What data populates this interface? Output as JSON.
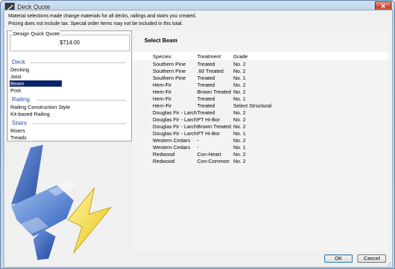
{
  "window": {
    "title": "Deck Quote",
    "close_glyph": "✕"
  },
  "notice": [
    "Material selections made change materials for all decks, railings and stairs you created.",
    "Pricing does not include tax.  Special order items may not be included in this total."
  ],
  "quote": {
    "label": "Design Quick Quote",
    "total": "$714.00"
  },
  "categories": {
    "deck": {
      "header": "Deck",
      "items": [
        "Decking",
        "Joist",
        "Beam",
        "Post"
      ]
    },
    "railing": {
      "header": "Railing",
      "items": [
        "Railing Construction Style",
        "Kit-based Railing"
      ]
    },
    "stairs": {
      "header": "Stairs",
      "items": [
        "Risers",
        "Treads"
      ]
    },
    "selected": "Beam"
  },
  "main": {
    "title": "Select Beam",
    "columns": [
      "Species",
      "Treatment",
      "Grade"
    ],
    "rows": [
      [
        "Southern Pine",
        "Treated",
        "No. 2"
      ],
      [
        "Southern Pine",
        ".60 Treated",
        "No. 2"
      ],
      [
        "Southern Pine",
        "Treated",
        "No. 1"
      ],
      [
        "Hem-Fir",
        "Treated",
        "No. 2"
      ],
      [
        "Hem-Fir",
        "Brown Treated",
        "No. 2"
      ],
      [
        "Hem-Fir",
        "Treated",
        "No. 1"
      ],
      [
        "Hem-Fir",
        "Treated",
        "Select Structural"
      ],
      [
        "Douglas Fir - Larch",
        "Treated",
        "No. 2"
      ],
      [
        "Douglas Fir - Larch",
        "PT Hi-Bor",
        "No. 2"
      ],
      [
        "Douglas Fir - Larch",
        "Brown Treated",
        "No. 2"
      ],
      [
        "Douglas Fir - Larch",
        "PT Hi-Bor",
        "No. 1"
      ],
      [
        "Western Cedars",
        "-",
        "No. 2"
      ],
      [
        "Western Cedars",
        "-",
        "No. 1"
      ],
      [
        "Redwood",
        "Con-Heart",
        "No. 2"
      ],
      [
        "Redwood",
        "Con-Common",
        "No. 2"
      ]
    ]
  },
  "buttons": {
    "ok": "OK",
    "cancel": "Cancel"
  },
  "icons": {
    "app": "deck-app-icon",
    "illustration": "paintbrush-lightning-icon",
    "grip": "resize-grip-icon"
  },
  "colors": {
    "selection": "#0a246a",
    "category_header": "#2d4b9a",
    "brush_blue": "#3a6fd0",
    "bolt_yellow": "#f2d21e"
  }
}
